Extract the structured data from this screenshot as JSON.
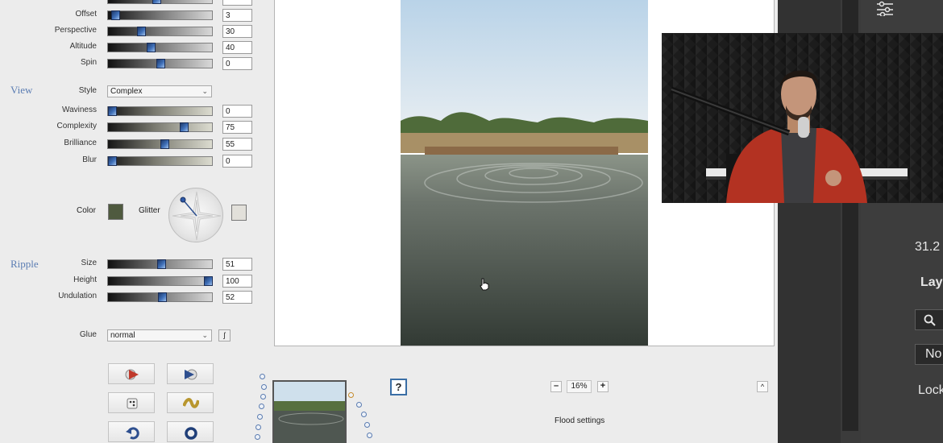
{
  "sections": {
    "view": "View",
    "ripple": "Ripple"
  },
  "top_sliders": [
    {
      "label": "Offset",
      "value": "3",
      "level": 0.03
    },
    {
      "label": "Perspective",
      "value": "30",
      "level": 0.3
    },
    {
      "label": "Altitude",
      "value": "40",
      "level": 0.4
    },
    {
      "label": "Spin",
      "value": "0",
      "level": 0.5
    }
  ],
  "view": {
    "style_label": "Style",
    "style_value": "Complex",
    "sliders": [
      {
        "label": "Waviness",
        "value": "0",
        "level": 0.0
      },
      {
        "label": "Complexity",
        "value": "75",
        "level": 0.75
      },
      {
        "label": "Brilliance",
        "value": "55",
        "level": 0.55
      },
      {
        "label": "Blur",
        "value": "0",
        "level": 0.0
      }
    ],
    "color_label": "Color",
    "color_value": "#4f5a3f",
    "glitter_label": "Glitter",
    "glitter_color": "#e2e0da"
  },
  "ripple": {
    "sliders": [
      {
        "label": "Size",
        "value": "51",
        "level": 0.51
      },
      {
        "label": "Height",
        "value": "100",
        "level": 1.0
      },
      {
        "label": "Undulation",
        "value": "52",
        "level": 0.52
      }
    ]
  },
  "glue": {
    "label": "Glue",
    "value": "normal"
  },
  "preview": {
    "help_label": "?",
    "zoom_out": "–",
    "zoom_value": "16%",
    "zoom_in": "+",
    "collapse": "^",
    "status": "Flood settings"
  },
  "dark_app": {
    "value_text": "31.2",
    "layers_text": "Lay",
    "blend_text": "No",
    "lock_text": "Lock"
  },
  "colors": {
    "accent": "#5b7db3",
    "dark_bg": "#3b3b3b"
  }
}
